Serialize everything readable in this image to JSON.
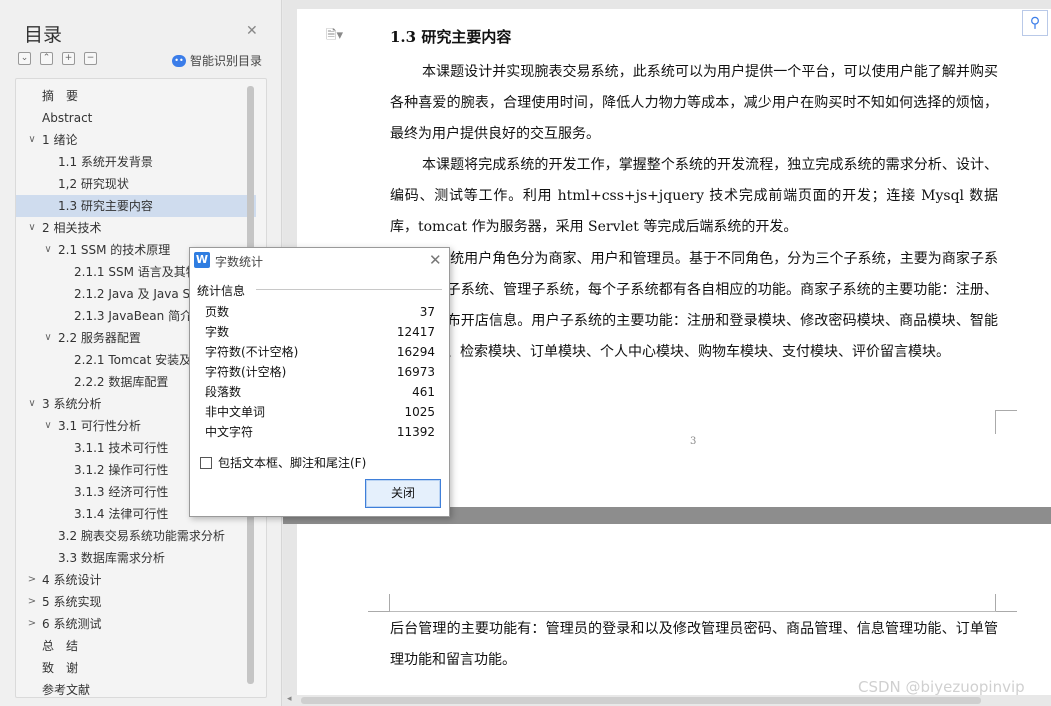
{
  "toc": {
    "title": "目录",
    "smart_label": "智能识别目录",
    "items": [
      {
        "label": "摘　要",
        "level": 1,
        "chevron": "",
        "active": false
      },
      {
        "label": "Abstract",
        "level": 1,
        "chevron": "",
        "active": false
      },
      {
        "label": "1 绪论",
        "level": 1,
        "chevron": "∨",
        "active": false
      },
      {
        "label": "1.1 系统开发背景",
        "level": 2,
        "chevron": "",
        "active": false
      },
      {
        "label": "1,2 研究现状",
        "level": 2,
        "chevron": "",
        "active": false
      },
      {
        "label": "1.3 研究主要内容",
        "level": 2,
        "chevron": "",
        "active": true
      },
      {
        "label": "2 相关技术",
        "level": 1,
        "chevron": "∨",
        "active": false
      },
      {
        "label": "2.1 SSM 的技术原理",
        "level": 2,
        "chevron": "∨",
        "active": false
      },
      {
        "label": "2.1.1 SSM 语言及其特",
        "level": 3,
        "chevron": "",
        "active": false
      },
      {
        "label": "2.1.2 Java 及 Java Se",
        "level": 3,
        "chevron": "",
        "active": false
      },
      {
        "label": "2.1.3 JavaBean 简介",
        "level": 3,
        "chevron": "",
        "active": false
      },
      {
        "label": "2.2 服务器配置",
        "level": 2,
        "chevron": "∨",
        "active": false
      },
      {
        "label": "2.2.1 Tomcat 安装及配",
        "level": 3,
        "chevron": "",
        "active": false
      },
      {
        "label": "2.2.2 数据库配置",
        "level": 3,
        "chevron": "",
        "active": false
      },
      {
        "label": "3 系统分析",
        "level": 1,
        "chevron": "∨",
        "active": false
      },
      {
        "label": "3.1 可行性分析",
        "level": 2,
        "chevron": "∨",
        "active": false
      },
      {
        "label": "3.1.1 技术可行性",
        "level": 3,
        "chevron": "",
        "active": false
      },
      {
        "label": "3.1.2 操作可行性",
        "level": 3,
        "chevron": "",
        "active": false
      },
      {
        "label": "3.1.3 经济可行性",
        "level": 3,
        "chevron": "",
        "active": false
      },
      {
        "label": "3.1.4 法律可行性",
        "level": 3,
        "chevron": "",
        "active": false
      },
      {
        "label": "3.2 腕表交易系统功能需求分析",
        "level": 2,
        "chevron": "",
        "active": false
      },
      {
        "label": "3.3 数据库需求分析",
        "level": 2,
        "chevron": "",
        "active": false
      },
      {
        "label": "4 系统设计",
        "level": 1,
        "chevron": ">",
        "active": false
      },
      {
        "label": "5 系统实现",
        "level": 1,
        "chevron": ">",
        "active": false
      },
      {
        "label": "6 系统测试",
        "level": 1,
        "chevron": ">",
        "active": false
      },
      {
        "label": "总　结",
        "level": 1,
        "chevron": "",
        "active": false
      },
      {
        "label": "致　谢",
        "level": 1,
        "chevron": "",
        "active": false
      },
      {
        "label": "参考文献",
        "level": 1,
        "chevron": "",
        "active": false
      }
    ]
  },
  "document": {
    "heading": "1.3 研究主要内容",
    "paragraph1": "本课题设计并实现腕表交易系统，此系统可以为用户提供一个平台，可以使用户能了解并购买各种喜爱的腕表，合理使用时间，降低人力物力等成本，减少用户在购买时不知如何选择的烦恼，最终为用户提供良好的交互服务。",
    "paragraph2": "本课题将完成系统的开发工作，掌握整个系统的开发流程，独立完成系统的需求分析、设计、编码、测试等工作。利用 html+css+js+jquery 技术完成前端页面的开发；连接 Mysql 数据库，tomcat 作为服务器，采用 Servlet 等完成后端系统的开发。",
    "paragraph3": "本系统用户角色分为商家、用户和管理员。基于不同角色，分为三个子系统，主要为商家子系统、用户子系统、管理子系统，每个子系统都有各自相应的功能。商家子系统的主要功能：注册、登录和发布开店信息。用户子系统的主要功能：注册和登录模块、修改密码模块、商品模块、智能推荐模块、检索模块、订单模块、个人中心模块、购物车模块、支付模块、评价留言模块。",
    "page_number": "3",
    "paragraph4": "后台管理的主要功能有：管理员的登录和以及修改管理员密码、商品管理、信息管理功能、订单管理功能和留言功能。"
  },
  "dialog": {
    "title": "字数统计",
    "section": "统计信息",
    "stats": [
      {
        "label": "页数",
        "value": "37"
      },
      {
        "label": "字数",
        "value": "12417"
      },
      {
        "label": "字符数(不计空格)",
        "value": "16294"
      },
      {
        "label": "字符数(计空格)",
        "value": "16973"
      },
      {
        "label": "段落数",
        "value": "461"
      },
      {
        "label": "非中文单词",
        "value": "1025"
      },
      {
        "label": "中文字符",
        "value": "11392"
      }
    ],
    "checkbox_label": "包括文本框、脚注和尾注(F)",
    "checkbox_checked": false,
    "close_button": "关闭"
  },
  "watermark": "CSDN @biyezuopinvip",
  "colors": {
    "accent": "#2f7de1",
    "active_item": "#cfdcee"
  }
}
